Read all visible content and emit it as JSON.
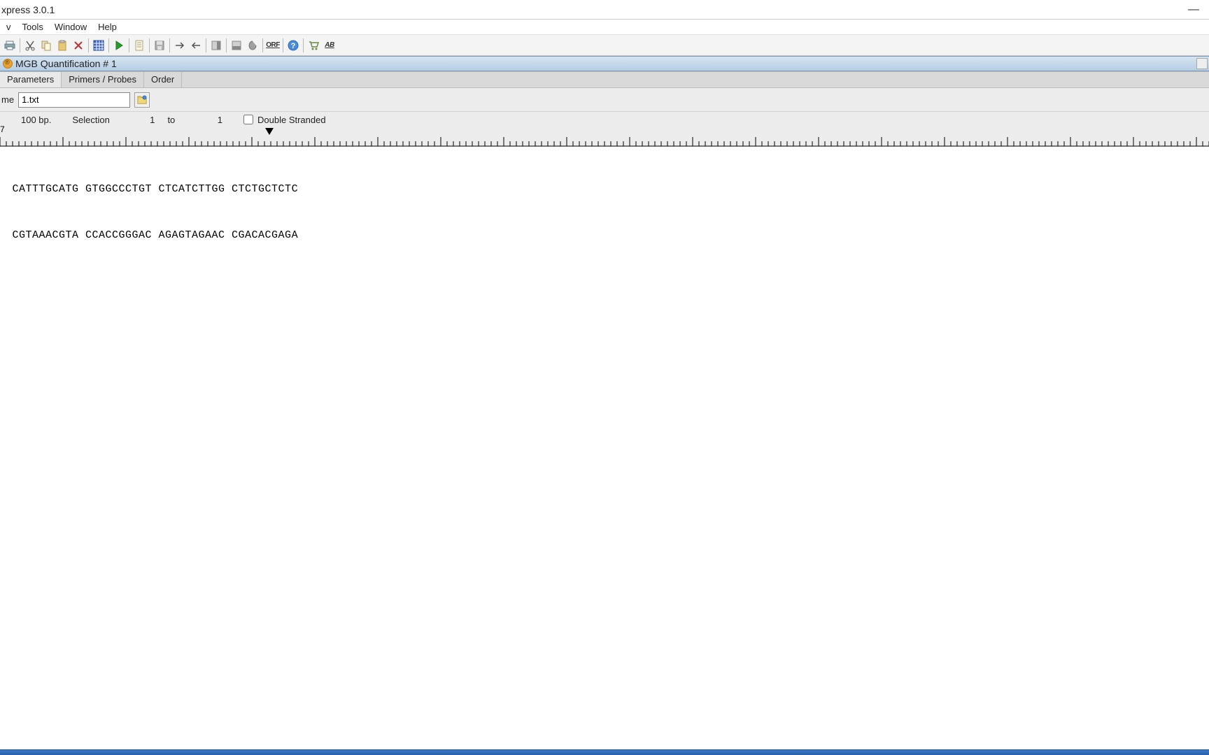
{
  "window": {
    "title": "xpress 3.0.1"
  },
  "menu": {
    "items": [
      "v",
      "Tools",
      "Window",
      "Help"
    ]
  },
  "toolbar": {
    "orf_label": "ORF",
    "ab_label": "AB"
  },
  "document": {
    "title": " MGB Quantification # 1"
  },
  "tabs": {
    "items": [
      "Parameters",
      "Primers / Probes",
      "Order"
    ],
    "active": 0
  },
  "form": {
    "name_label": "me",
    "name_value": "1.txt"
  },
  "info": {
    "bp_label": "100 bp.",
    "selection_label": "Selection",
    "sel_from": "1",
    "sel_to_label": "to",
    "sel_to": "1",
    "double_stranded_label": "Double Stranded",
    "double_stranded_checked": false
  },
  "sequence": {
    "line1": " CATTTGCATG GTGGCCCTGT CTCATCTTGG CTCTGCTCTC",
    "line2": " CGTAAACGTA CCACCGGGAC AGAGTAGAAC CGACACGAGA"
  },
  "ruler": {
    "start_label": "7"
  }
}
